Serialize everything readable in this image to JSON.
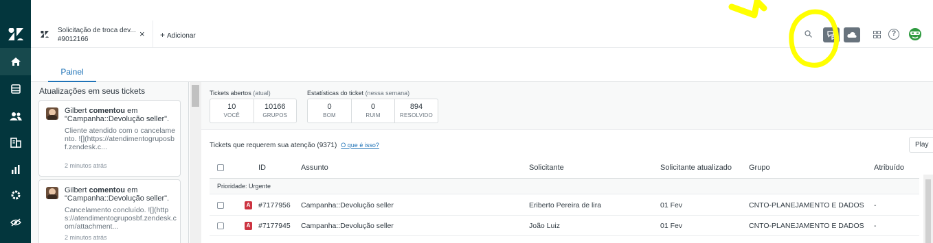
{
  "nav": {
    "items": [
      "home-icon",
      "views-icon",
      "customers-icon",
      "organizations-icon",
      "reporting-icon",
      "admin-icon",
      "visibility-icon"
    ]
  },
  "tab": {
    "title": "Solicitação de troca dev...",
    "subtitle": "#9012166",
    "close": "×",
    "add_label": "Adicionar"
  },
  "panel": {
    "tab_label": "Painel"
  },
  "updates": {
    "title": "Atualizações em seus tickets",
    "cards": [
      {
        "author": "Gilbert",
        "action": "comentou",
        "preposition": "em",
        "target": "\"Campanha::Devolução seller\".",
        "body": "Cliente atendido com o cancelamento. ![](https://atendimentogruposbf.zendesk.c...",
        "time": "2 minutos atrás"
      },
      {
        "author": "Gilbert",
        "action": "comentou",
        "preposition": "em",
        "target": "\"Campanha::Devolução seller\".",
        "body": "Cancelamento concluído. ![](https://atendimentogruposbf.zendesk.com/attachment...",
        "time": "2 minutos atrás"
      }
    ]
  },
  "stats": {
    "open_label": "Tickets abertos",
    "open_note": "(atual)",
    "open": [
      {
        "value": "10",
        "caption": "VOCÊ"
      },
      {
        "value": "10166",
        "caption": "GRUPOS"
      }
    ],
    "stats_label": "Estatísticas do ticket",
    "stats_note": "(nessa semana)",
    "week": [
      {
        "value": "0",
        "caption": "BOM"
      },
      {
        "value": "0",
        "caption": "RUIM"
      },
      {
        "value": "894",
        "caption": "RESOLVIDO"
      }
    ]
  },
  "tickets": {
    "title": "Tickets que requerem sua atenção (9371)",
    "help_link": "O que é isso?",
    "play": "Play",
    "columns": {
      "id": "ID",
      "subject": "Assunto",
      "requester": "Solicitante",
      "requester_updated": "Solicitante atualizado",
      "group": "Grupo",
      "assignee": "Atribuído"
    },
    "group_label": "Prioridade: Urgente",
    "rows": [
      {
        "status": "A",
        "id": "#7177956",
        "subject": "Campanha::Devolução seller",
        "requester": "Eriberto Pereira de lira",
        "updated": "01 Fev",
        "group": "CNTO-PLANEJAMENTO E DADOS",
        "assignee": "-"
      },
      {
        "status": "A",
        "id": "#7177945",
        "subject": "Campanha::Devolução seller",
        "requester": "João Luiz",
        "updated": "01 Fev",
        "group": "CNTO-PLANEJAMENTO E DADOS",
        "assignee": "-"
      }
    ]
  },
  "colors": {
    "nav_bg": "#03363d",
    "accent": "#1f73b7",
    "urgent_badge": "#cc3340",
    "annotation": "#ffff00"
  }
}
